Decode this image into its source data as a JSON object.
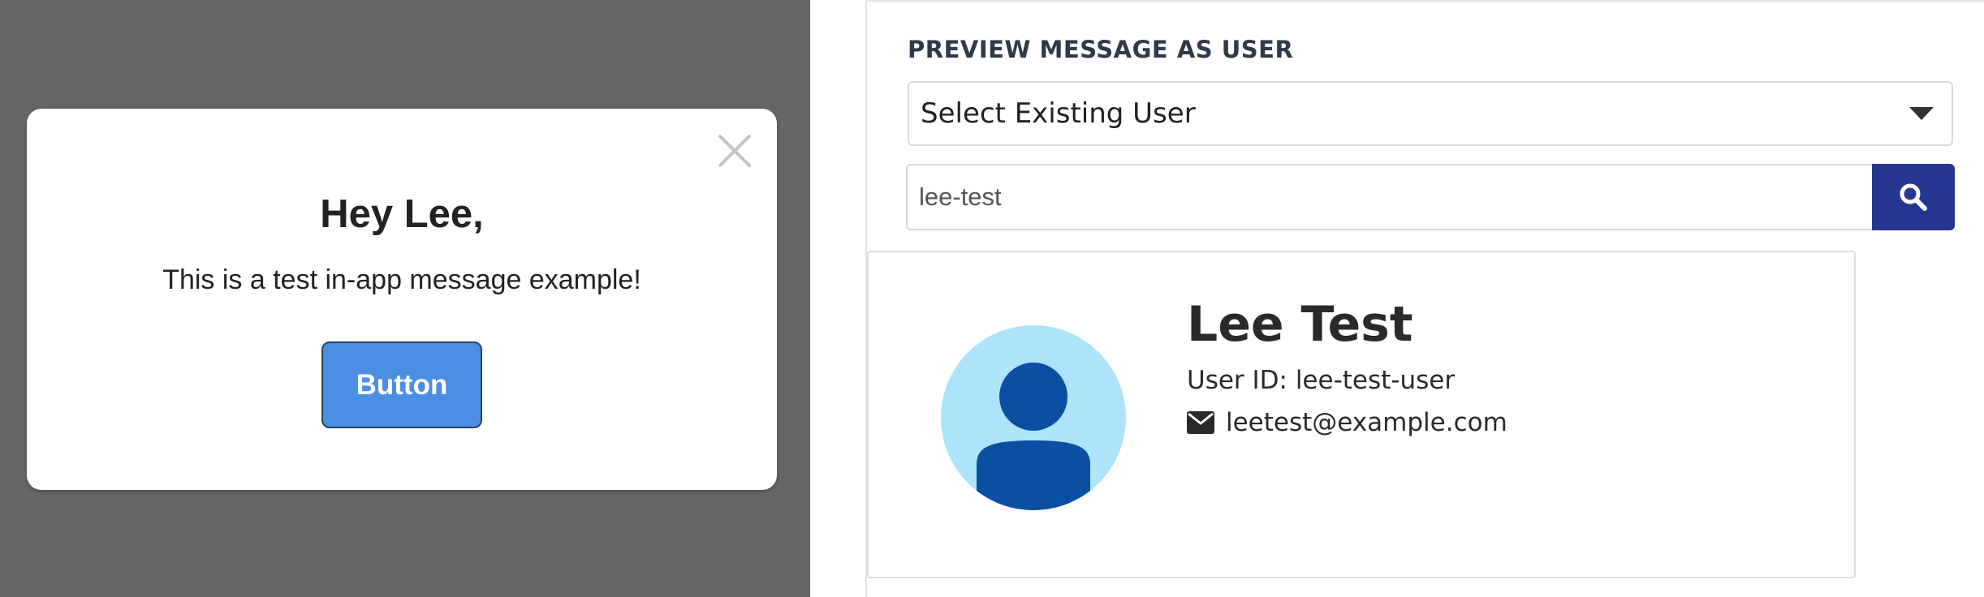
{
  "preview": {
    "modal": {
      "title": "Hey Lee,",
      "body": "This is a test in-app message example!",
      "button_label": "Button",
      "close_icon": "close-icon"
    },
    "colors": {
      "backdrop": "#666666",
      "button": "#4a8fe3"
    }
  },
  "settings": {
    "section_title": "PREVIEW MESSAGE AS USER",
    "user_select": {
      "selected": "Select Existing User",
      "icon": "chevron-down-icon"
    },
    "search": {
      "value": "lee-test",
      "icon": "search-icon",
      "button_color": "#25368f"
    },
    "user_card": {
      "name": "Lee Test",
      "user_id": "User ID: lee-test-user",
      "email": "leetest@example.com",
      "email_icon": "envelope-icon",
      "avatar_icon": "user-avatar-icon",
      "avatar_bg": "#aee4fb",
      "avatar_fg": "#0b4fa3"
    }
  }
}
